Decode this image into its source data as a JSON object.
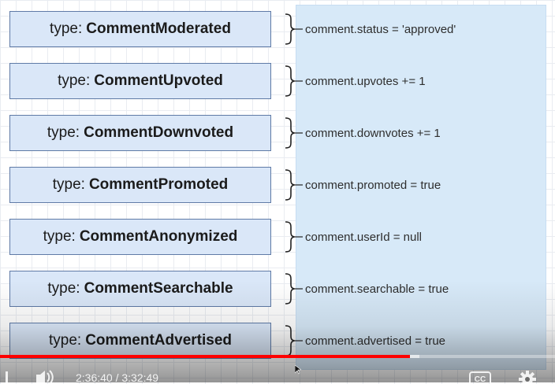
{
  "slide": {
    "events": [
      {
        "prefix": "type:",
        "name": "CommentModerated",
        "effect": "comment.status = 'approved'"
      },
      {
        "prefix": "type:",
        "name": "CommentUpvoted",
        "effect": "comment.upvotes += 1"
      },
      {
        "prefix": "type:",
        "name": "CommentDownvoted",
        "effect": "comment.downvotes += 1"
      },
      {
        "prefix": "type:",
        "name": "CommentPromoted",
        "effect": "comment.promoted = true"
      },
      {
        "prefix": "type:",
        "name": "CommentAnonymized",
        "effect": "comment.userId = null"
      },
      {
        "prefix": "type:",
        "name": "CommentSearchable",
        "effect": "comment.searchable = true"
      },
      {
        "prefix": "type:",
        "name": "CommentAdvertised",
        "effect": "comment.advertised = true"
      }
    ]
  },
  "player": {
    "time_display": "2:36:40 / 3:32:49",
    "progress": 0.738,
    "buffered": 0.755,
    "colors": {
      "progress": "#ff0000"
    },
    "icons": [
      "play-pause-icon",
      "next-icon",
      "volume-icon",
      "captions-icon",
      "settings-icon"
    ]
  }
}
